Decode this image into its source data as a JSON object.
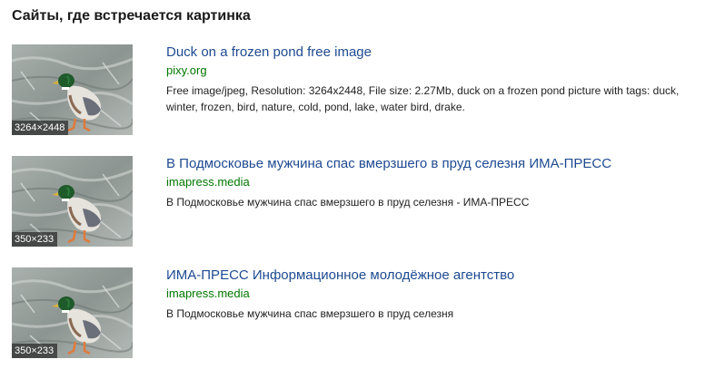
{
  "page": {
    "title": "Сайты, где встречается картинка"
  },
  "colors": {
    "link": "#1e4a91",
    "domain": "#007700",
    "text": "#222222"
  },
  "results": [
    {
      "title": "Duck on a frozen pond free image",
      "domain": "pixy.org",
      "description": "Free image/jpeg, Resolution: 3264x2448, File size: 2.27Mb, duck on a frozen pond picture with tags: duck, winter, frozen, bird, nature, cold, pond, lake, water bird, drake.",
      "thumb_size": "3264×2448",
      "thumb_icon": "duck-image"
    },
    {
      "title": "В Подмосковье мужчина спас вмерзшего в пруд селезня ИМА-ПРЕСС",
      "domain": "imapress.media",
      "description": "В Подмосковье мужчина спас вмерзшего в пруд селезня - ИМА-ПРЕСС",
      "thumb_size": "350×233",
      "thumb_icon": "duck-image"
    },
    {
      "title": "ИМА-ПРЕСС Информационное молодёжное агентство",
      "domain": "imapress.media",
      "description": "В Подмосковье мужчина спас вмерзшего в пруд селезня",
      "thumb_size": "350×233",
      "thumb_icon": "duck-image"
    }
  ]
}
